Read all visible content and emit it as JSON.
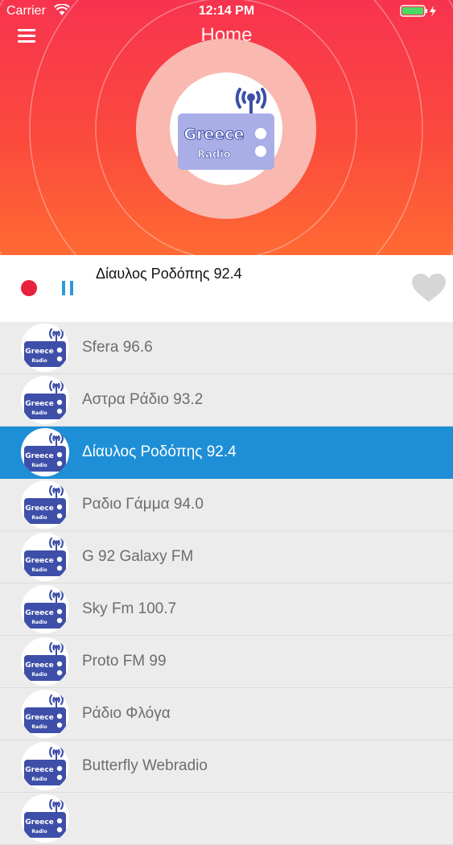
{
  "status_bar": {
    "carrier": "Carrier",
    "time": "12:14 PM"
  },
  "header": {
    "title": "Home"
  },
  "logo": {
    "line1": "Greece",
    "line2": "Radio"
  },
  "player": {
    "now_playing": "Δίαυλος Ροδόπης 92.4"
  },
  "colors": {
    "header_top": "#f7334f",
    "header_bottom": "#ff6a33",
    "accent": "#2f97e0",
    "record": "#e8213d",
    "selected_row": "#1e8fd6"
  },
  "stations": [
    {
      "name": "Sfera 96.6",
      "selected": false
    },
    {
      "name": "Αστρα Ράδιο 93.2",
      "selected": false
    },
    {
      "name": "Δίαυλος Ροδόπης 92.4",
      "selected": true
    },
    {
      "name": "Ραδιο Γάμμα 94.0",
      "selected": false
    },
    {
      "name": "G 92 Galaxy FM",
      "selected": false
    },
    {
      "name": "Sky Fm 100.7",
      "selected": false
    },
    {
      "name": "Proto FM 99",
      "selected": false
    },
    {
      "name": "Ράδιο Φλόγα",
      "selected": false
    },
    {
      "name": "Butterfly Webradio",
      "selected": false
    },
    {
      "name": "",
      "selected": false
    }
  ]
}
